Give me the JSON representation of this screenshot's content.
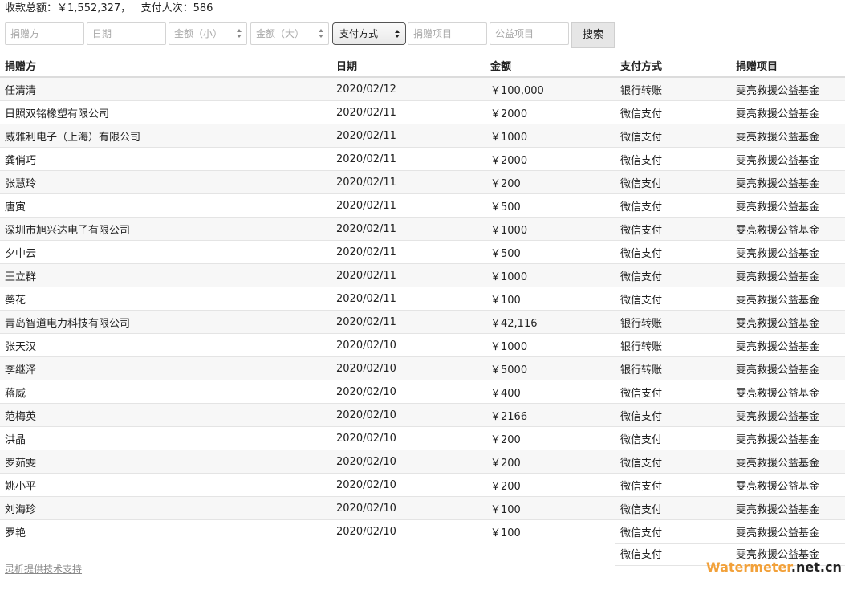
{
  "summary": {
    "total_label": "收款总额：",
    "total_value": "￥1,552,327，",
    "count_label": "支付人次：",
    "count_value": "586"
  },
  "filters": {
    "donor_placeholder": "捐赠方",
    "date_placeholder": "日期",
    "amount_min_placeholder": "金额（小）",
    "amount_max_placeholder": "金额（大）",
    "payment_method_selected": "支付方式",
    "project_placeholder": "捐赠项目",
    "charity_placeholder": "公益项目",
    "search_label": "搜索"
  },
  "table": {
    "headers": [
      "捐赠方",
      "日期",
      "金额",
      "支付方式",
      "捐赠项目"
    ],
    "rows": [
      [
        "任清清",
        "2020/02/12",
        "￥100,000",
        "银行转账",
        "雯亮救援公益基金"
      ],
      [
        "日照双铭橡塑有限公司",
        "2020/02/11",
        "￥2000",
        "微信支付",
        "雯亮救援公益基金"
      ],
      [
        "威雅利电子（上海）有限公司",
        "2020/02/11",
        "￥1000",
        "微信支付",
        "雯亮救援公益基金"
      ],
      [
        "龚俏巧",
        "2020/02/11",
        "￥2000",
        "微信支付",
        "雯亮救援公益基金"
      ],
      [
        "张慧玲",
        "2020/02/11",
        "￥200",
        "微信支付",
        "雯亮救援公益基金"
      ],
      [
        "唐寅",
        "2020/02/11",
        "￥500",
        "微信支付",
        "雯亮救援公益基金"
      ],
      [
        "深圳市旭兴达电子有限公司",
        "2020/02/11",
        "￥1000",
        "微信支付",
        "雯亮救援公益基金"
      ],
      [
        "夕中云",
        "2020/02/11",
        "￥500",
        "微信支付",
        "雯亮救援公益基金"
      ],
      [
        "王立群",
        "2020/02/11",
        "￥1000",
        "微信支付",
        "雯亮救援公益基金"
      ],
      [
        "葵花",
        "2020/02/11",
        "￥100",
        "微信支付",
        "雯亮救援公益基金"
      ],
      [
        "青岛智道电力科技有限公司",
        "2020/02/11",
        "￥42,116",
        "银行转账",
        "雯亮救援公益基金"
      ],
      [
        "张天汉",
        "2020/02/10",
        "￥1000",
        "银行转账",
        "雯亮救援公益基金"
      ],
      [
        "李继泽",
        "2020/02/10",
        "￥5000",
        "银行转账",
        "雯亮救援公益基金"
      ],
      [
        "蒋威",
        "2020/02/10",
        "￥400",
        "微信支付",
        "雯亮救援公益基金"
      ],
      [
        "范梅英",
        "2020/02/10",
        "￥2166",
        "微信支付",
        "雯亮救援公益基金"
      ],
      [
        "洪晶",
        "2020/02/10",
        "￥200",
        "微信支付",
        "雯亮救援公益基金"
      ],
      [
        "罗茹雯",
        "2020/02/10",
        "￥200",
        "微信支付",
        "雯亮救援公益基金"
      ],
      [
        "姚小平",
        "2020/02/10",
        "￥200",
        "微信支付",
        "雯亮救援公益基金"
      ],
      [
        "刘海珍",
        "2020/02/10",
        "￥100",
        "微信支付",
        "雯亮救援公益基金"
      ],
      [
        "罗艳",
        "2020/02/10",
        "￥100",
        "微信支付",
        "雯亮救援公益基金"
      ]
    ],
    "partial_row": {
      "payment": "微信支付",
      "project": "雯亮救援公益基金"
    }
  },
  "footer": {
    "support_link": "灵析提供技术支持"
  },
  "watermark": {
    "part1": "Watermeter",
    "part2": ".net.cn",
    "colors": {
      "part1": "#f2a13a",
      "part2": "#222222"
    }
  }
}
